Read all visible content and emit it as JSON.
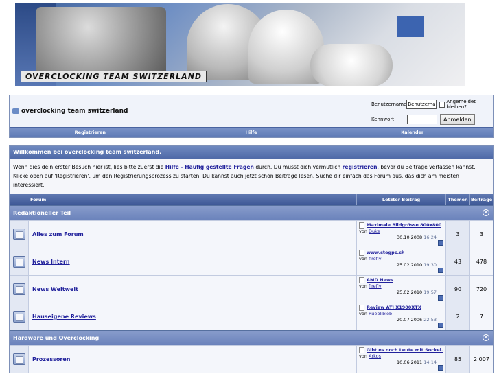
{
  "banner": {
    "title": "OVERCLOCKING TEAM SWITZERLAND"
  },
  "navbar": {
    "site_name": "overclocking team switzerland",
    "username_label": "Benutzername",
    "username_value": "Benutzername",
    "remember_label": "Angemeldet bleiben?",
    "password_label": "Kennwort",
    "login_button": "Anmelden",
    "menu": [
      "Registrieren",
      "Hilfe",
      "Kalender"
    ]
  },
  "welcome": {
    "heading": "Willkommen bei overclocking team switzerland.",
    "text_1": "Wenn dies dein erster Besuch hier ist, lies bitte zuerst die ",
    "link_faq": "Hilfe - Häufig gestellte Fragen",
    "text_2": " durch. Du musst dich vermutlich ",
    "link_register": "registrieren",
    "text_3": ", bevor du Beiträge verfassen kannst. Klicke oben auf 'Registrieren', um den Registrierungsprozess zu starten. Du kannst auch jetzt schon Beiträge lesen. Suche dir einfach das Forum aus, das dich am meisten interessiert."
  },
  "forum": {
    "headers": {
      "forum": "Forum",
      "last_post": "Letzter Beitrag",
      "threads": "Themen",
      "posts": "Beiträge"
    },
    "categories": [
      {
        "name": "Redaktioneller Teil",
        "collapse_icon": "collapse-icon",
        "forums": [
          {
            "name": "Alles zum Forum",
            "last_title": "Maximale Bildgrösse 800x800",
            "by": "von",
            "user": "Duke",
            "date": "30.10.2008",
            "time": "16:24",
            "threads": "3",
            "posts": "3"
          },
          {
            "name": "News Intern",
            "last_title": "www.stegpc.ch",
            "by": "von",
            "user": "firefly",
            "date": "25.02.2010",
            "time": "19:30",
            "threads": "43",
            "posts": "478"
          },
          {
            "name": "News Weltweit",
            "last_title": "AMD News",
            "by": "von",
            "user": "firefly",
            "date": "25.02.2010",
            "time": "19:57",
            "threads": "90",
            "posts": "720"
          },
          {
            "name": "Hauseigene Reviews",
            "last_title": "Review ATI X1900XTX",
            "by": "von",
            "user": "Rueblibleb",
            "date": "20.07.2006",
            "time": "22:53",
            "threads": "2",
            "posts": "7"
          }
        ]
      },
      {
        "name": "Hardware und Overclocking",
        "collapse_icon": "collapse-icon",
        "forums": [
          {
            "name": "Prozessoren",
            "last_title": "Gibt es noch Leute mit Sockel...",
            "by": "von",
            "user": "Arkos",
            "date": "10.06.2011",
            "time": "14:14",
            "threads": "85",
            "posts": "2.007"
          }
        ]
      }
    ]
  }
}
